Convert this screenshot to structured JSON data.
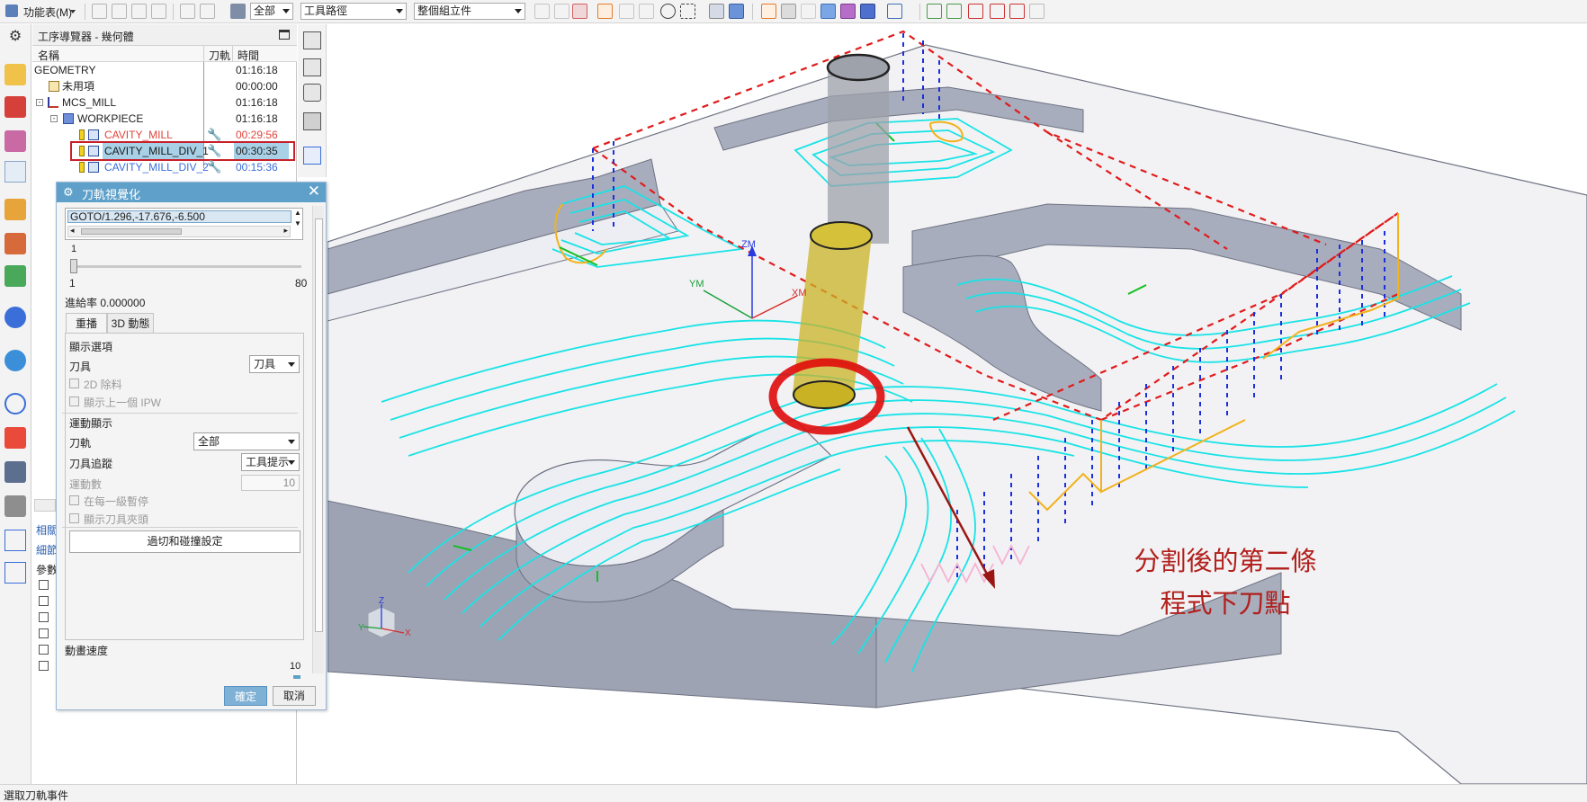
{
  "toolbar": {
    "menu_label": "功能表(M)",
    "filter_select": "全部",
    "path_select": "工具路徑",
    "assembly_select": "整個組立件"
  },
  "navigator": {
    "title": "工序導覽器 - 幾何體",
    "columns": {
      "name": "名稱",
      "toolpath": "刀軌",
      "time": "時間"
    },
    "rows": [
      {
        "name": "GEOMETRY",
        "time": "01:16:18",
        "color": "#222222"
      },
      {
        "name": "未用項",
        "time": "00:00:00",
        "color": "#222222"
      },
      {
        "name": "MCS_MILL",
        "time": "01:16:18",
        "color": "#222222"
      },
      {
        "name": "WORKPIECE",
        "time": "01:16:18",
        "color": "#222222"
      },
      {
        "name": "CAVITY_MILL",
        "time": "00:29:56",
        "color": "#e0453a"
      },
      {
        "name": "CAVITY_MILL_DIV_1",
        "time": "00:30:35",
        "color": "#1a1a1a"
      },
      {
        "name": "CAVITY_MILL_DIV_2",
        "time": "00:15:36",
        "color": "#3a6ed8"
      }
    ],
    "lower_labels": {
      "related": "相關",
      "details": "細節",
      "param": "參數"
    }
  },
  "dialog": {
    "title": "刀軌視覺化",
    "goto_line": "GOTO/1.296,-17.676,-6.500",
    "slider_current": "1",
    "slider_min": "1",
    "slider_max": "80",
    "feedrate": "進給率 0.000000",
    "tabs": [
      "重播",
      "3D 動態"
    ],
    "display_options_label": "顯示選項",
    "tool_label": "刀具",
    "tool_value": "刀具",
    "remove_2d_label": "2D 除料",
    "show_prev_ipw_label": "顯示上一個 IPW",
    "motion_display_label": "運動顯示",
    "toolpath_label": "刀軌",
    "toolpath_value": "全部",
    "tool_trace_label": "刀具追蹤",
    "tool_trace_value": "工具提示",
    "motion_count_label": "運動數",
    "motion_count_value": "10",
    "pause_each_label": "在每一級暫停",
    "show_holder_label": "顯示刀具夾頭",
    "gouge_button": "過切和碰撞設定",
    "anim_speed_label": "動畫速度",
    "anim_speed_value": "10",
    "ok_button": "確定",
    "cancel_button": "取消"
  },
  "viewport": {
    "annotation_line1": "分割後的第二條",
    "annotation_line2": "程式下刀點",
    "axis_labels": {
      "zm": "ZM",
      "ym": "YM",
      "xm": "XM",
      "z": "Z",
      "y": "Y",
      "x": "X"
    },
    "colors": {
      "part_face": "#a8adbd",
      "part_top": "#f2f2f4",
      "toolpath": "#19e3e6",
      "rapid": "#e11b1b",
      "engage": "#1a2fe0",
      "cutter": "#c9b325",
      "highlight": "#e00b0b",
      "arrow": "#9b1612"
    }
  },
  "status": {
    "text": "選取刀軌事件"
  }
}
